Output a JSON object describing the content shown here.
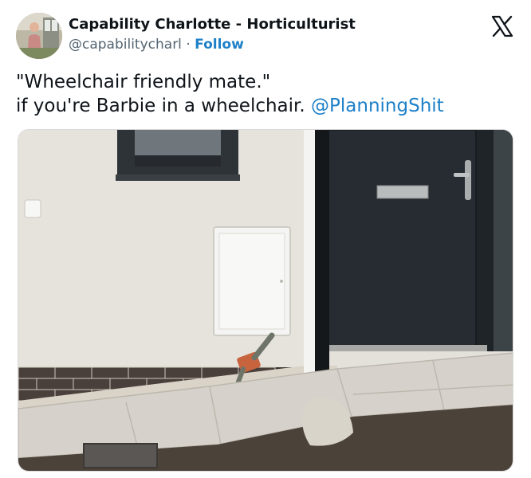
{
  "author": {
    "display_name": "Capability Charlotte - Horticulturist",
    "handle": "@capabilitycharl",
    "separator": "·",
    "follow_label": "Follow"
  },
  "tweet": {
    "line1": "\"Wheelchair friendly mate.\"",
    "line2": "if you're Barbie in a wheelchair.",
    "mention": "@PlanningShit"
  },
  "icons": {
    "brand": "x-logo-icon",
    "avatar": "profile-photo"
  }
}
